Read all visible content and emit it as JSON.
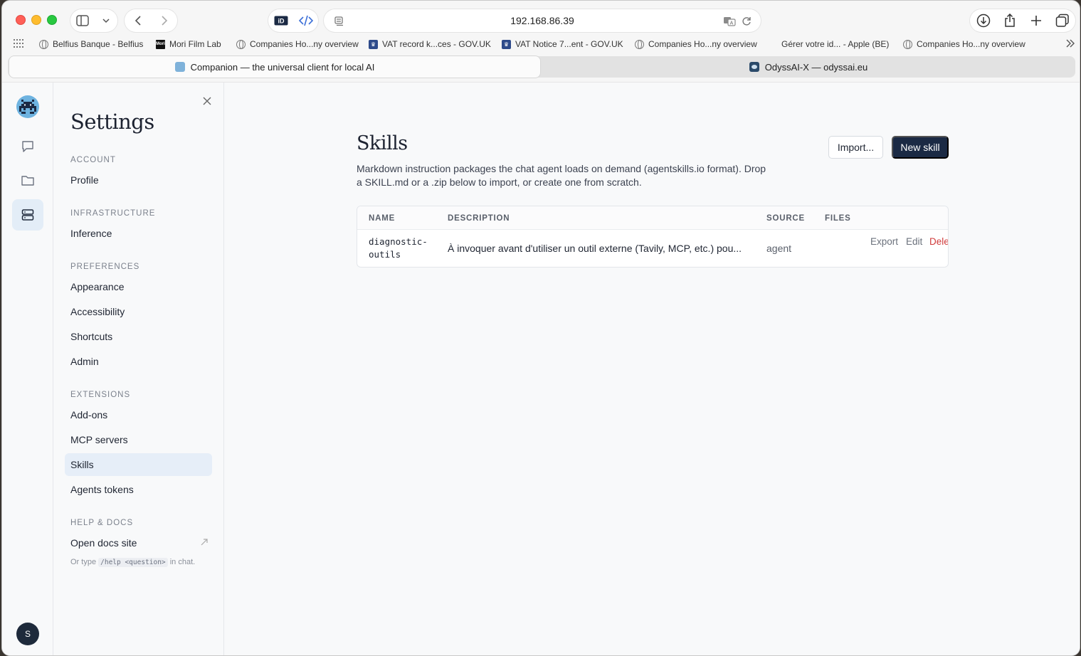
{
  "browser": {
    "url": "192.168.86.39",
    "bookmarks": [
      {
        "label": "Belfius Banque - Belfius",
        "icon": "globe-icon"
      },
      {
        "label": "Mori Film Lab",
        "icon": "mori-icon"
      },
      {
        "label": "Companies Ho...ny overview",
        "icon": "globe-icon"
      },
      {
        "label": "VAT record k...ces - GOV.UK",
        "icon": "gov-icon"
      },
      {
        "label": "VAT Notice 7...ent - GOV.UK",
        "icon": "gov-icon"
      },
      {
        "label": "Companies Ho...ny overview",
        "icon": "globe-icon"
      },
      {
        "label": "Gérer votre id... - Apple (BE)",
        "icon": "apple-icon"
      },
      {
        "label": "Companies Ho...ny overview",
        "icon": "globe-icon"
      }
    ],
    "tabs": [
      {
        "title": "Companion — the universal client for local AI",
        "active": true
      },
      {
        "title": "OdyssAI-X — odyssai.eu",
        "active": false
      }
    ]
  },
  "rail": {
    "avatar_initial": "S"
  },
  "settings": {
    "title": "Settings",
    "sections": [
      {
        "label": "ACCOUNT",
        "items": [
          "Profile"
        ]
      },
      {
        "label": "INFRASTRUCTURE",
        "items": [
          "Inference"
        ]
      },
      {
        "label": "PREFERENCES",
        "items": [
          "Appearance",
          "Accessibility",
          "Shortcuts",
          "Admin"
        ]
      },
      {
        "label": "EXTENSIONS",
        "items": [
          "Add-ons",
          "MCP servers",
          "Skills",
          "Agents tokens"
        ]
      },
      {
        "label": "HELP & DOCS",
        "items": [
          "Open docs site"
        ]
      }
    ],
    "active_item": "Skills",
    "hint_prefix": "Or type",
    "hint_code": "/help <question>",
    "hint_suffix": "in chat."
  },
  "main": {
    "title": "Skills",
    "description": "Markdown instruction packages the chat agent loads on demand (agentskills.io format). Drop a SKILL.md or a .zip below to import, or create one from scratch.",
    "import_label": "Import...",
    "new_label": "New skill",
    "table": {
      "columns": [
        "NAME",
        "DESCRIPTION",
        "SOURCE",
        "FILES"
      ],
      "rows": [
        {
          "name_line1": "diagnostic-",
          "name_line2": "outils",
          "description": "À invoquer avant d'utiliser un outil externe (Tavily, MCP, etc.) pou...",
          "source": "agent",
          "files": "",
          "actions": [
            "Export",
            "Edit",
            "Dele"
          ]
        }
      ]
    }
  },
  "colors": {
    "accent": "#1b2a44",
    "danger": "#d03b3b",
    "active_nav": "#e6eef8"
  }
}
